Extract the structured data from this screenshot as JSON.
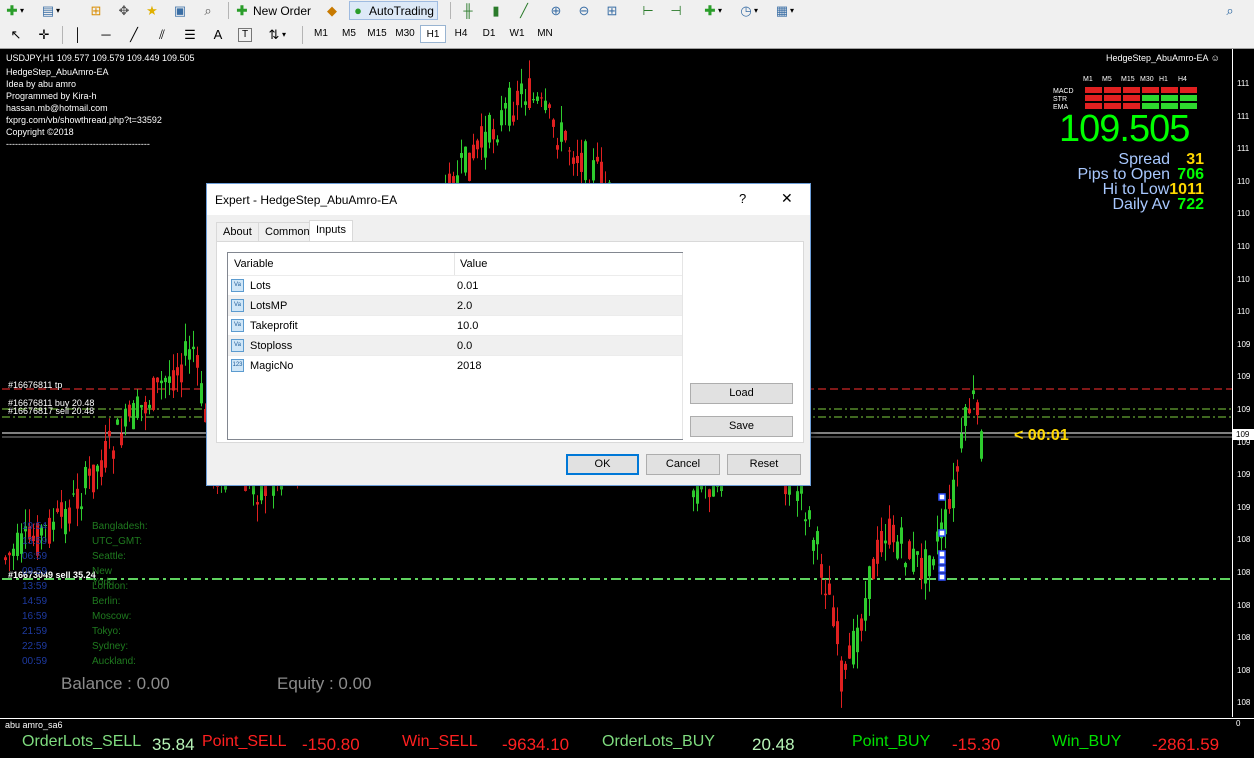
{
  "toolbar": {
    "new_order_label": "New Order",
    "autotrading_label": "AutoTrading",
    "timeframes": [
      "M1",
      "M5",
      "M15",
      "M30",
      "H1",
      "H4",
      "D1",
      "W1",
      "MN"
    ],
    "active_timeframe": "H1"
  },
  "chart": {
    "symbol_line": "USDJPY,H1  109.577 109.579 109.449 109.505",
    "ea_name": "HedgeStep_AbuAmro-EA",
    "info_lines": [
      "HedgeStep_AbuAmro-EA",
      "Idea by abu amro",
      "Programmed by Kira-h",
      "hassan.mb@hotmail.com",
      "fxprg.com/vb/showthread.php?t=33592",
      "Copyright ©2018",
      "------------------------------------------------"
    ],
    "price_ticks": [
      "111",
      "111",
      "111",
      "110",
      "110",
      "110",
      "110",
      "110",
      "109",
      "109",
      "109",
      "109",
      "109",
      "109",
      "108",
      "108",
      "108",
      "108",
      "108",
      "108"
    ],
    "current_price_tick": "109",
    "order_labels": {
      "tp": "#16676811 tp",
      "buy": "#16676811 buy 20.48",
      "sell": "#16676817 sell 20.48",
      "sell2": "#16673049 sell 35.24"
    },
    "timer": "< 00:01",
    "balance": "Balance : 0.00",
    "equity": "Equity : 0.00",
    "clock_names": [
      "Bangladesh:",
      "UTC_GMT:",
      "Seattle:",
      "New York:",
      "London:",
      "Berlin:",
      "Moscow:",
      "Tokyo:",
      "Sydney:",
      "Auckland:"
    ],
    "clock_times": [
      "19:54",
      "13:59",
      "06:59",
      "09:59",
      "13:59",
      "14:59",
      "16:59",
      "21:59",
      "22:59",
      "00:59"
    ]
  },
  "panel": {
    "tf_headers": [
      "M1",
      "M5",
      "M15",
      "M30",
      "H1",
      "H4"
    ],
    "row_labels": [
      "MACD",
      "STR",
      "EMA"
    ],
    "price": "109.505",
    "stats": [
      {
        "label": "Spread",
        "value": "31"
      },
      {
        "label": "Pips to Open",
        "value": "706"
      },
      {
        "label": "Hi to Low",
        "value": "1011"
      },
      {
        "label": "Daily Av",
        "value": "722"
      }
    ]
  },
  "subwindow": {
    "name": "abu amro_sa6",
    "right_tick": "0",
    "order_lots_sell_label": "OrderLots_SELL",
    "order_lots_sell_value": "35.84",
    "point_sell_label": "Point_SELL",
    "point_sell_value": "-150.80",
    "win_sell_label": "Win_SELL",
    "win_sell_value": "-9634.10",
    "order_lots_buy_label": "OrderLots_BUY",
    "order_lots_buy_value": "20.48",
    "point_buy_label": "Point_BUY",
    "point_buy_value": "-15.30",
    "win_buy_label": "Win_BUY",
    "win_buy_value": "-2861.59"
  },
  "dialog": {
    "title": "Expert - HedgeStep_AbuAmro-EA",
    "help": "?",
    "close": "✕",
    "tabs": [
      "About",
      "Common",
      "Inputs"
    ],
    "columns": [
      "Variable",
      "Value"
    ],
    "rows": [
      {
        "icon": "Va",
        "name": "Lots",
        "value": "0.01"
      },
      {
        "icon": "Va",
        "name": "LotsMP",
        "value": "2.0"
      },
      {
        "icon": "Va",
        "name": "Takeprofit",
        "value": "10.0"
      },
      {
        "icon": "Va",
        "name": "Stoploss",
        "value": "0.0"
      },
      {
        "icon": "123",
        "name": "MagicNo",
        "value": "2018"
      }
    ],
    "load": "Load",
    "save": "Save",
    "ok": "OK",
    "cancel": "Cancel",
    "reset": "Reset"
  }
}
